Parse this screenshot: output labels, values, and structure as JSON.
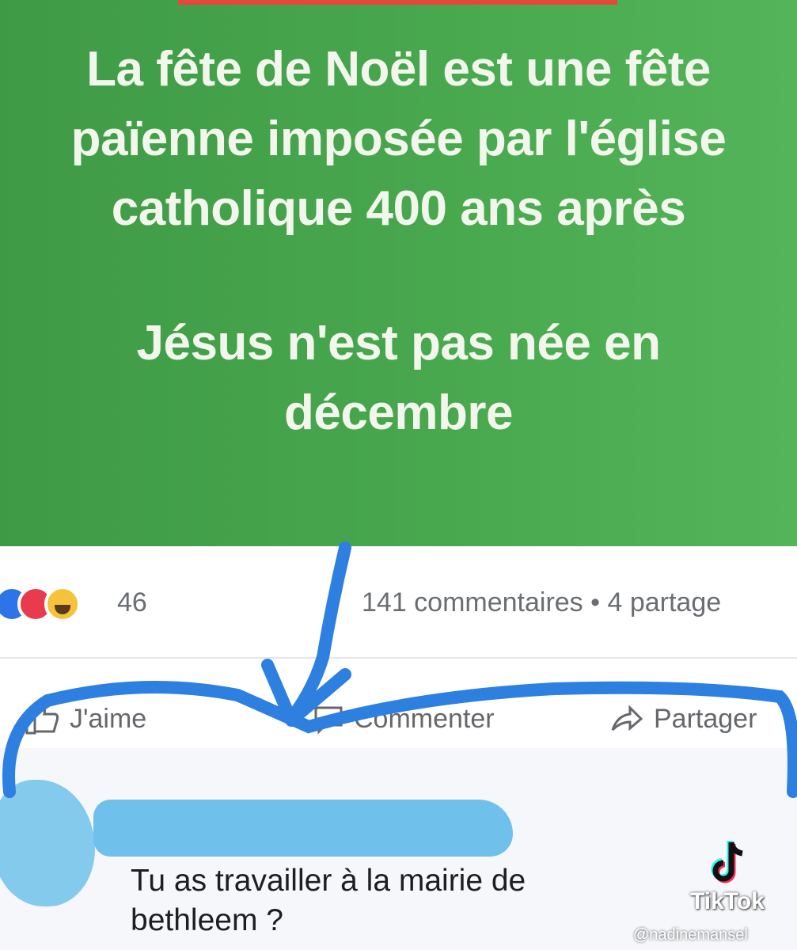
{
  "post": {
    "headline": "La fête de Noël est une fête\npaïenne imposée par l'église\ncatholique 400 ans après",
    "subline": "Jésus n'est pas née en\ndécembre"
  },
  "reactions": {
    "icons": [
      "like-icon",
      "love-icon",
      "haha-icon"
    ],
    "count": "46",
    "comments_shares": "141 commentaires • 4 partage"
  },
  "actions": {
    "like_label": "J'aime",
    "comment_label": "Commenter",
    "share_label": "Partager"
  },
  "comment": {
    "text": "Tu as travailler à la mairie de\nbethleem ?"
  },
  "watermark": {
    "brand": "TikTok",
    "handle": "@nadinemansel"
  },
  "colors": {
    "post_background": "#48a84e",
    "scribble": "#2d7fe0",
    "redaction": "#6fc0ea"
  }
}
